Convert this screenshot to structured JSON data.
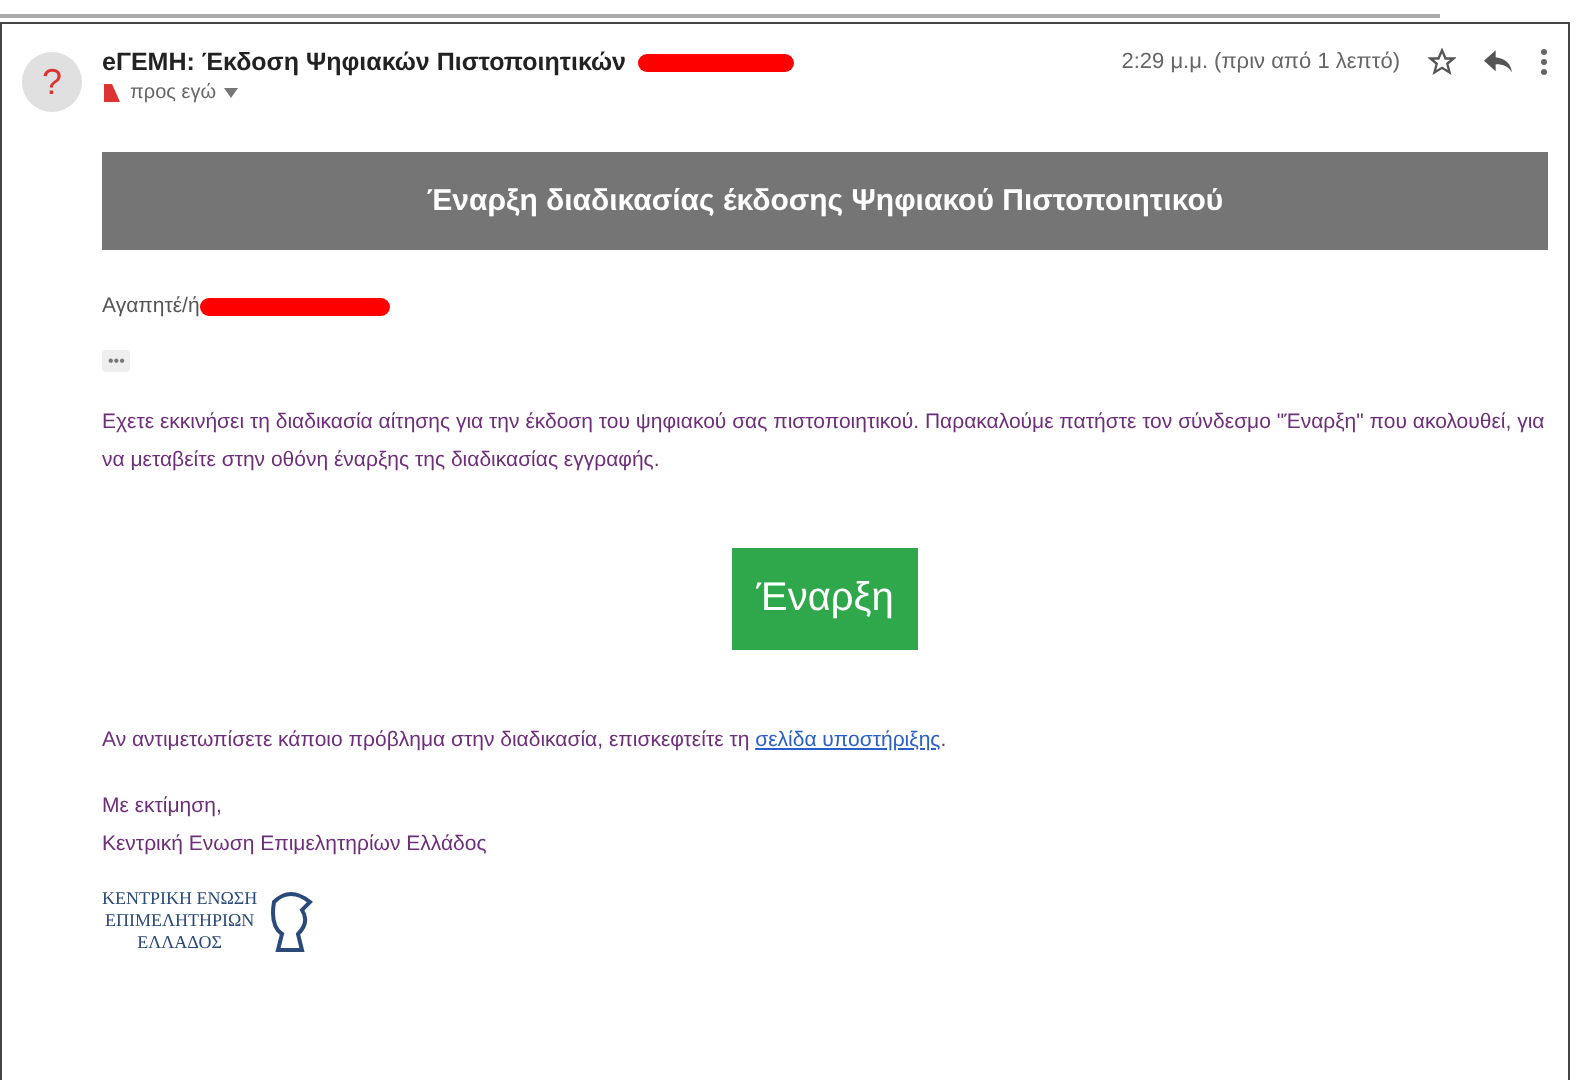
{
  "email": {
    "subject": "eΓΕΜΗ: Έκδοση Ψηφιακών Πιστοποιητικών",
    "recipient": "προς εγώ",
    "time": "2:29 μ.μ. (πριν από 1 λεπτό)",
    "avatar": "?"
  },
  "body": {
    "banner": "Έναρξη διαδικασίας έκδοσης Ψηφιακού Πιστοποιητικού",
    "greeting": "Αγαπητέ/ή",
    "ellipsis": "•••",
    "paragraph": "Εχετε εκκινήσει τη διαδικασία αίτησης για την έκδοση του ψηφιακού σας πιστοποιητικού. Παρακαλούμε πατήστε τον σύνδεσμο \"Έναρξη\" που ακολουθεί, για να μεταβείτε στην οθόνη έναρξης της διαδικασίας εγγραφής.",
    "button": "Έναρξη",
    "support_text": "Αν αντιμετωπίσετε κάποιο πρόβλημα στην διαδικασία, επισκεφτείτε τη ",
    "support_link": "σελίδα υποστήριξης",
    "support_end": ".",
    "closing": "Με εκτίμηση,",
    "signature": "Κεντρική Ενωση Επιμελητηρίων Ελλάδος",
    "logo_lines": [
      "ΚΕΝΤΡΙΚΗ ΕΝΩΣΗ",
      "ΕΠΙΜΕΛΗΤΗΡΙΩΝ",
      "ΕΛΛΑΔΟΣ"
    ]
  }
}
